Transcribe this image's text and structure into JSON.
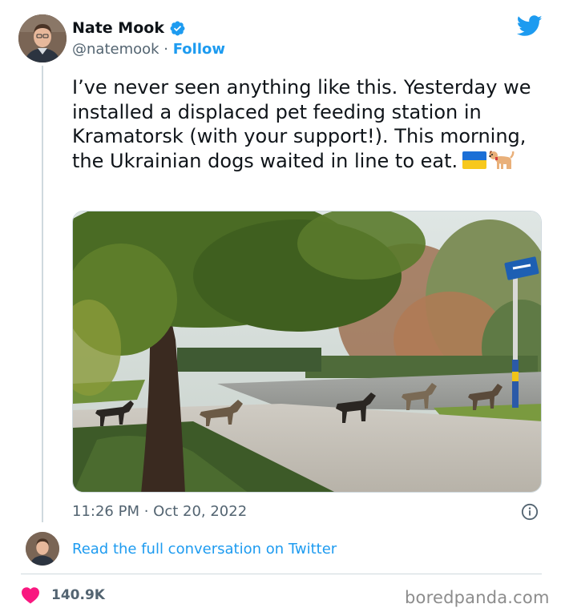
{
  "author": {
    "name": "Nate Mook",
    "handle": "@natemook",
    "separator": " · ",
    "follow_label": "Follow"
  },
  "tweet": {
    "text": "I’ve never seen anything like this. Yesterday we installed a displaced pet feeding station in Kramatorsk (with your support!). This morning, the Ukrainian dogs waited in line to eat.",
    "emojis": [
      "ukraine-flag-emoji",
      "dog-emoji"
    ],
    "photo_alt": "Dogs waiting in line on a sidewalk beside a tree in Kramatorsk",
    "timestamp": "11:26 PM · Oct 20, 2022"
  },
  "footer": {
    "read_link": "Read the full conversation on Twitter",
    "likes": "140.9K",
    "watermark": "boredpanda.com"
  },
  "colors": {
    "accent": "#1d9bf0",
    "like": "#f91880",
    "muted": "#536471"
  },
  "icons": [
    "verified-badge-icon",
    "twitter-bird-icon",
    "info-icon",
    "heart-icon"
  ]
}
